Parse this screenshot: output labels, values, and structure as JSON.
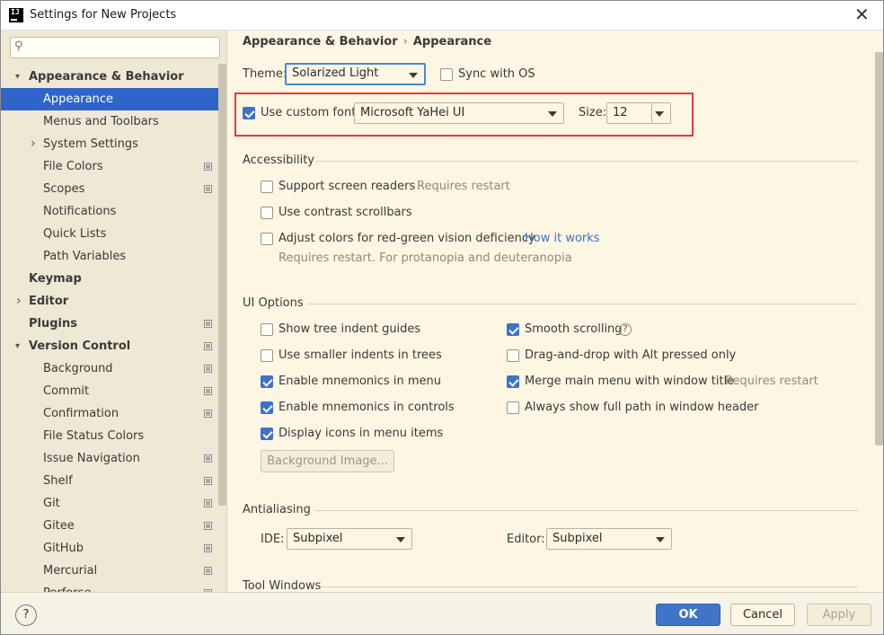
{
  "window": {
    "title": "Settings for New Projects",
    "app_icon": "IJ"
  },
  "search": {
    "placeholder": "",
    "icon": "search-icon"
  },
  "sidebar": {
    "items": [
      {
        "label": "Appearance & Behavior",
        "arrow": "▾"
      },
      {
        "label": "Appearance"
      },
      {
        "label": "Menus and Toolbars"
      },
      {
        "label": "System Settings",
        "arrow": "›"
      },
      {
        "label": "File Colors"
      },
      {
        "label": "Scopes"
      },
      {
        "label": "Notifications"
      },
      {
        "label": "Quick Lists"
      },
      {
        "label": "Path Variables"
      },
      {
        "label": "Keymap"
      },
      {
        "label": "Editor",
        "arrow": "›"
      },
      {
        "label": "Plugins"
      },
      {
        "label": "Version Control",
        "arrow": "▾"
      },
      {
        "label": "Background"
      },
      {
        "label": "Commit"
      },
      {
        "label": "Confirmation"
      },
      {
        "label": "File Status Colors"
      },
      {
        "label": "Issue Navigation"
      },
      {
        "label": "Shelf"
      },
      {
        "label": "Git"
      },
      {
        "label": "Gitee"
      },
      {
        "label": "GitHub"
      },
      {
        "label": "Mercurial"
      },
      {
        "label": "Perforce"
      }
    ]
  },
  "breadcrumb": {
    "parent": "Appearance & Behavior",
    "separator": "›",
    "current": "Appearance"
  },
  "theme": {
    "label": "Theme:",
    "value": "Solarized Light",
    "sync_label": "Sync with OS",
    "sync_checked": false
  },
  "font": {
    "checkbox_label": "Use custom font:",
    "checked": true,
    "value": "Microsoft YaHei UI",
    "size_label": "Size:",
    "size_value": "12"
  },
  "accessibility": {
    "title": "Accessibility",
    "screen_readers": "Support screen readers",
    "screen_readers_hint": "Requires restart",
    "contrast_scrollbars": "Use contrast scrollbars",
    "adjust_colors": "Adjust colors for red-green vision deficiency",
    "how_it_works": "How it works",
    "adjust_hint": "Requires restart. For protanopia and deuteranopia"
  },
  "ui_options": {
    "title": "UI Options",
    "left": [
      {
        "label": "Show tree indent guides",
        "checked": false
      },
      {
        "label": "Use smaller indents in trees",
        "checked": false
      },
      {
        "label": "Enable mnemonics in menu",
        "checked": true
      },
      {
        "label": "Enable mnemonics in controls",
        "checked": true
      },
      {
        "label": "Display icons in menu items",
        "checked": true
      }
    ],
    "right": [
      {
        "label": "Smooth scrolling",
        "checked": true
      },
      {
        "label": "Drag-and-drop with Alt pressed only",
        "checked": false
      },
      {
        "label": "Merge main menu with window title",
        "checked": true,
        "hint": "Requires restart"
      },
      {
        "label": "Always show full path in window header",
        "checked": false
      }
    ],
    "background_button": "Background Image..."
  },
  "antialiasing": {
    "title": "Antialiasing",
    "ide_label": "IDE:",
    "ide_value": "Subpixel",
    "editor_label": "Editor:",
    "editor_value": "Subpixel"
  },
  "tool_windows": {
    "title": "Tool Windows"
  },
  "buttons": {
    "help": "?",
    "ok": "OK",
    "cancel": "Cancel",
    "apply": "Apply"
  },
  "colors": {
    "accent": "#2f65ca",
    "highlight_box": "#e03b3b",
    "link": "#3d73c5",
    "content_bg": "#fdf6e3",
    "sidebar_bg": "#eee8d5"
  }
}
